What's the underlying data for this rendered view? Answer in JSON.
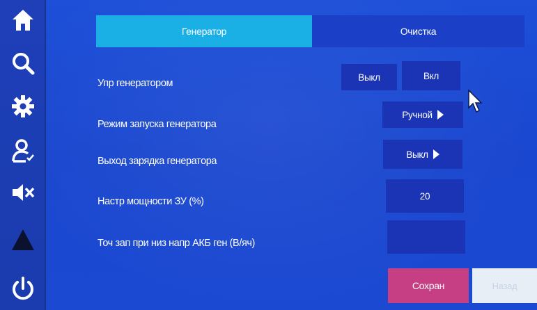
{
  "tabs": {
    "active": "Генератор",
    "inactive": "Очистка"
  },
  "rows": [
    {
      "label": "Упр генератором",
      "off": "Выкл",
      "on": "Вкл"
    },
    {
      "label": "Режим запуска генератора",
      "value": "Ручной"
    },
    {
      "label": "Выход зарядка генератора",
      "value": "Выкл"
    },
    {
      "label": "Настр мощности ЗУ (%)",
      "value": "20"
    },
    {
      "label": "Точ зап при низ напр АКБ ген (В/яч)",
      "value": ""
    }
  ],
  "footer": {
    "save": "Сохран",
    "back": "Назад"
  },
  "sidebar_icons": [
    "home-icon",
    "search-icon",
    "gear-icon",
    "user-check-icon",
    "mute-icon",
    "warning-icon",
    "power-icon"
  ],
  "colors": {
    "background": "#1b49d2",
    "tab_active": "#1ab0e6",
    "save": "#c63f85"
  }
}
